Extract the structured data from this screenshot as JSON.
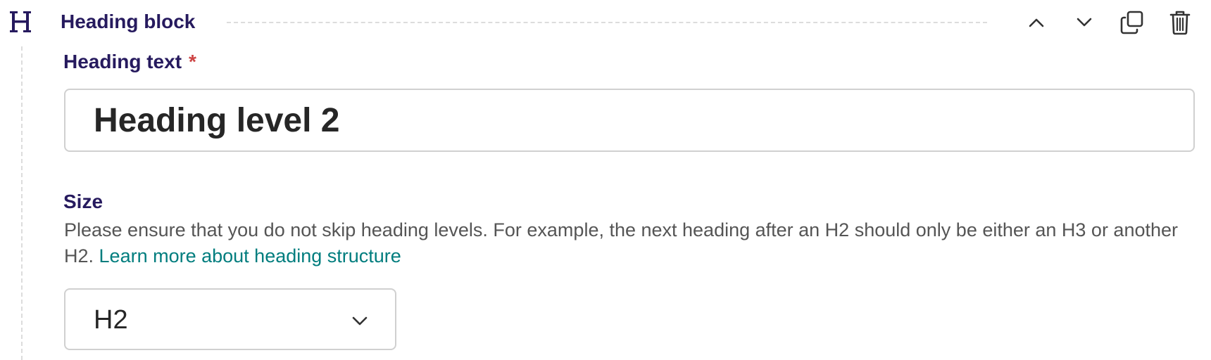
{
  "block": {
    "title": "Heading block",
    "type_icon": "heading-h-icon",
    "actions": {
      "move_up_icon": "chevron-up-icon",
      "move_down_icon": "chevron-down-icon",
      "duplicate_icon": "duplicate-icon",
      "delete_icon": "trash-icon"
    }
  },
  "heading_field": {
    "label": "Heading text",
    "required_marker": "*",
    "value": "Heading level 2"
  },
  "size_field": {
    "label": "Size",
    "help_text": "Please ensure that you do not skip heading levels. For example, the next heading after an H2 should only be either an H3 or another H2. ",
    "help_link": "Learn more about heading structure",
    "selected": "H2"
  },
  "colors": {
    "label": "#261a5e",
    "link": "#007d7e",
    "required": "#cd4444",
    "border": "#d0d0d0"
  }
}
